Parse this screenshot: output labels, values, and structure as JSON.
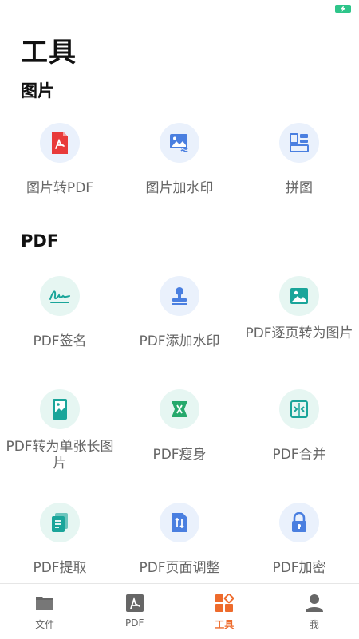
{
  "page_title": "工具",
  "sections": {
    "image": {
      "title": "图片",
      "tools": [
        "图片转PDF",
        "图片加水印",
        "拼图"
      ]
    },
    "pdf": {
      "title": "PDF",
      "tools": [
        "PDF签名",
        "PDF添加水印",
        "PDF逐页转为图片",
        "PDF转为单张长图片",
        "PDF瘦身",
        "PDF合并",
        "PDF提取",
        "PDF页面调整",
        "PDF加密"
      ]
    }
  },
  "bottom_nav": [
    {
      "label": "文件",
      "icon": "folder-icon"
    },
    {
      "label": "PDF",
      "icon": "pdf-icon"
    },
    {
      "label": "工具",
      "icon": "tools-icon",
      "active": true
    },
    {
      "label": "我",
      "icon": "person-icon"
    }
  ],
  "colors": {
    "accent": "#ee6b2c",
    "battery": "#2ec58a",
    "pdf_red": "#e83a3a",
    "blue_icon": "#4a7fe0",
    "teal_icon": "#1aa59a",
    "green_icon": "#26a96c"
  }
}
